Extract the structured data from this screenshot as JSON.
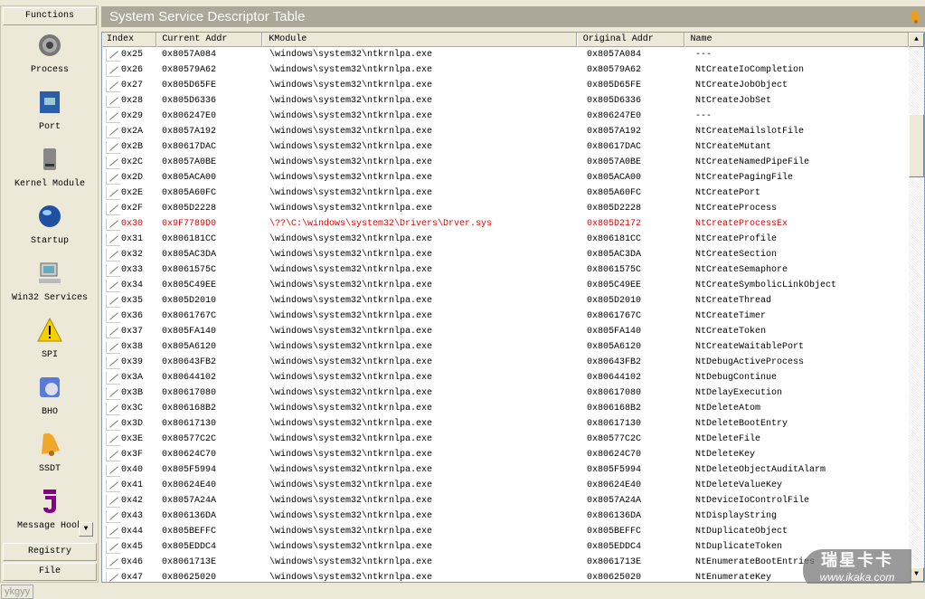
{
  "sidebar": {
    "functions_label": "Functions",
    "tools": [
      {
        "label": "Process",
        "icon": "gear-icon"
      },
      {
        "label": "Port",
        "icon": "network-port-icon"
      },
      {
        "label": "Kernel Module",
        "icon": "disk-drive-icon"
      },
      {
        "label": "Startup",
        "icon": "globe-icon"
      },
      {
        "label": "Win32 Services",
        "icon": "computer-icon"
      },
      {
        "label": "SPI",
        "icon": "warning-icon"
      },
      {
        "label": "BHO",
        "icon": "browser-icon"
      },
      {
        "label": "SSDT",
        "icon": "bell-icon"
      },
      {
        "label": "Message Hook",
        "icon": "hook-icon"
      }
    ],
    "registry_label": "Registry",
    "file_label": "File"
  },
  "panel": {
    "title": "System Service Descriptor Table"
  },
  "table": {
    "columns": [
      "Index",
      "Current Addr",
      "KModule",
      "Original Addr",
      "Name"
    ],
    "rows": [
      [
        "0x25",
        "0x8057A084",
        "\\windows\\system32\\ntkrnlpa.exe",
        "0x8057A084",
        "---"
      ],
      [
        "0x26",
        "0x80579A62",
        "\\windows\\system32\\ntkrnlpa.exe",
        "0x80579A62",
        "NtCreateIoCompletion"
      ],
      [
        "0x27",
        "0x805D65FE",
        "\\windows\\system32\\ntkrnlpa.exe",
        "0x805D65FE",
        "NtCreateJobObject"
      ],
      [
        "0x28",
        "0x805D6336",
        "\\windows\\system32\\ntkrnlpa.exe",
        "0x805D6336",
        "NtCreateJobSet"
      ],
      [
        "0x29",
        "0x806247E0",
        "\\windows\\system32\\ntkrnlpa.exe",
        "0x806247E0",
        "---"
      ],
      [
        "0x2A",
        "0x8057A192",
        "\\windows\\system32\\ntkrnlpa.exe",
        "0x8057A192",
        "NtCreateMailslotFile"
      ],
      [
        "0x2B",
        "0x80617DAC",
        "\\windows\\system32\\ntkrnlpa.exe",
        "0x80617DAC",
        "NtCreateMutant"
      ],
      [
        "0x2C",
        "0x8057A0BE",
        "\\windows\\system32\\ntkrnlpa.exe",
        "0x8057A0BE",
        "NtCreateNamedPipeFile"
      ],
      [
        "0x2D",
        "0x805ACA00",
        "\\windows\\system32\\ntkrnlpa.exe",
        "0x805ACA00",
        "NtCreatePagingFile"
      ],
      [
        "0x2E",
        "0x805A60FC",
        "\\windows\\system32\\ntkrnlpa.exe",
        "0x805A60FC",
        "NtCreatePort"
      ],
      [
        "0x2F",
        "0x805D2228",
        "\\windows\\system32\\ntkrnlpa.exe",
        "0x805D2228",
        "NtCreateProcess"
      ],
      [
        "0x30",
        "0x9F7789D0",
        "\\??\\C:\\windows\\system32\\Drivers\\Drver.sys",
        "0x805D2172",
        "NtCreateProcessEx"
      ],
      [
        "0x31",
        "0x806181CC",
        "\\windows\\system32\\ntkrnlpa.exe",
        "0x806181CC",
        "NtCreateProfile"
      ],
      [
        "0x32",
        "0x805AC3DA",
        "\\windows\\system32\\ntkrnlpa.exe",
        "0x805AC3DA",
        "NtCreateSection"
      ],
      [
        "0x33",
        "0x8061575C",
        "\\windows\\system32\\ntkrnlpa.exe",
        "0x8061575C",
        "NtCreateSemaphore"
      ],
      [
        "0x34",
        "0x805C49EE",
        "\\windows\\system32\\ntkrnlpa.exe",
        "0x805C49EE",
        "NtCreateSymbolicLinkObject"
      ],
      [
        "0x35",
        "0x805D2010",
        "\\windows\\system32\\ntkrnlpa.exe",
        "0x805D2010",
        "NtCreateThread"
      ],
      [
        "0x36",
        "0x8061767C",
        "\\windows\\system32\\ntkrnlpa.exe",
        "0x8061767C",
        "NtCreateTimer"
      ],
      [
        "0x37",
        "0x805FA140",
        "\\windows\\system32\\ntkrnlpa.exe",
        "0x805FA140",
        "NtCreateToken"
      ],
      [
        "0x38",
        "0x805A6120",
        "\\windows\\system32\\ntkrnlpa.exe",
        "0x805A6120",
        "NtCreateWaitablePort"
      ],
      [
        "0x39",
        "0x80643FB2",
        "\\windows\\system32\\ntkrnlpa.exe",
        "0x80643FB2",
        "NtDebugActiveProcess"
      ],
      [
        "0x3A",
        "0x80644102",
        "\\windows\\system32\\ntkrnlpa.exe",
        "0x80644102",
        "NtDebugContinue"
      ],
      [
        "0x3B",
        "0x80617080",
        "\\windows\\system32\\ntkrnlpa.exe",
        "0x80617080",
        "NtDelayExecution"
      ],
      [
        "0x3C",
        "0x806168B2",
        "\\windows\\system32\\ntkrnlpa.exe",
        "0x806168B2",
        "NtDeleteAtom"
      ],
      [
        "0x3D",
        "0x80617130",
        "\\windows\\system32\\ntkrnlpa.exe",
        "0x80617130",
        "NtDeleteBootEntry"
      ],
      [
        "0x3E",
        "0x80577C2C",
        "\\windows\\system32\\ntkrnlpa.exe",
        "0x80577C2C",
        "NtDeleteFile"
      ],
      [
        "0x3F",
        "0x80624C70",
        "\\windows\\system32\\ntkrnlpa.exe",
        "0x80624C70",
        "NtDeleteKey"
      ],
      [
        "0x40",
        "0x805F5994",
        "\\windows\\system32\\ntkrnlpa.exe",
        "0x805F5994",
        "NtDeleteObjectAuditAlarm"
      ],
      [
        "0x41",
        "0x80624E40",
        "\\windows\\system32\\ntkrnlpa.exe",
        "0x80624E40",
        "NtDeleteValueKey"
      ],
      [
        "0x42",
        "0x8057A24A",
        "\\windows\\system32\\ntkrnlpa.exe",
        "0x8057A24A",
        "NtDeviceIoControlFile"
      ],
      [
        "0x43",
        "0x806136DA",
        "\\windows\\system32\\ntkrnlpa.exe",
        "0x806136DA",
        "NtDisplayString"
      ],
      [
        "0x44",
        "0x805BEFFC",
        "\\windows\\system32\\ntkrnlpa.exe",
        "0x805BEFFC",
        "NtDuplicateObject"
      ],
      [
        "0x45",
        "0x805EDDC4",
        "\\windows\\system32\\ntkrnlpa.exe",
        "0x805EDDC4",
        "NtDuplicateToken"
      ],
      [
        "0x46",
        "0x8061713E",
        "\\windows\\system32\\ntkrnlpa.exe",
        "0x8061713E",
        "NtEnumerateBootEntries"
      ],
      [
        "0x47",
        "0x80625020",
        "\\windows\\system32\\ntkrnlpa.exe",
        "0x80625020",
        "NtEnumerateKey"
      ]
    ],
    "hooked_indices": [
      "0x30"
    ],
    "hooked_color": "#e00000"
  },
  "watermark": {
    "big": "瑞星卡卡",
    "small": "www.ikaka.com"
  },
  "statusbar": {
    "text": "ykgyy"
  }
}
